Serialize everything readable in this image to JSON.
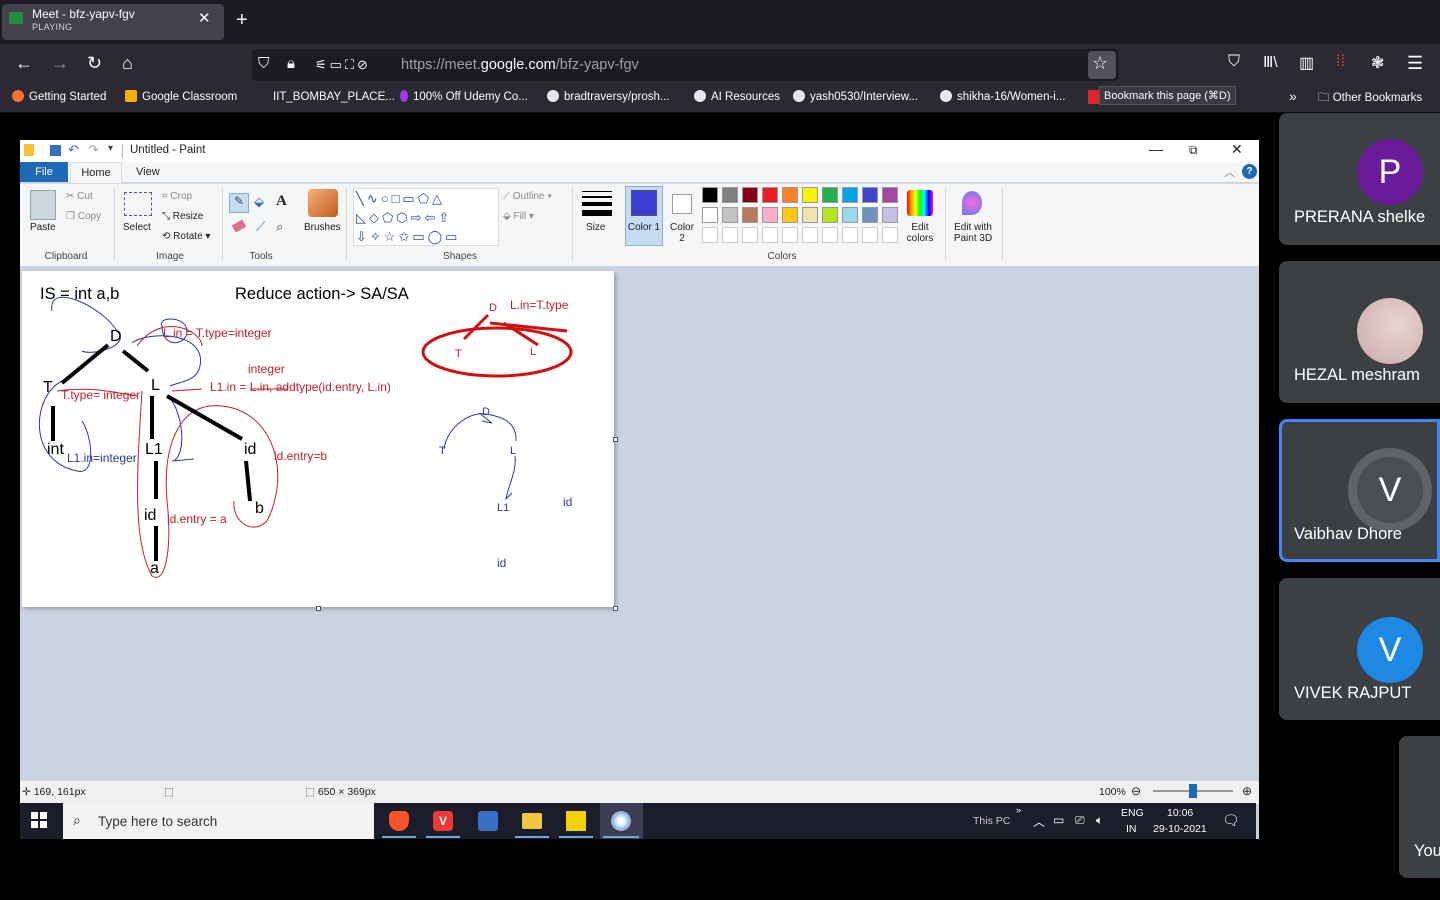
{
  "browser": {
    "tab": {
      "title": "Meet - bfz-yapv-fgv",
      "status": "PLAYING"
    },
    "url": {
      "scheme": "https://meet.",
      "host": "google.com",
      "path": "/bfz-yapv-fgv"
    },
    "bookmarks": [
      "Getting Started",
      "Google Classroom",
      "IIT_BOMBAY_PLACE...",
      "100% Off Udemy Co...",
      "bradtraversy/prosh...",
      "AI Resources",
      "yash0530/Interview...",
      "shikha-16/Women-i..."
    ],
    "tooltip": "Bookmark this page (⌘D)",
    "other_bookmarks": "Other Bookmarks",
    "icons": [
      "back-icon",
      "forward-icon",
      "reload-icon",
      "home-icon",
      "shield-icon",
      "lock-icon",
      "star-icon",
      "pocket-icon",
      "library-icon",
      "sidebar-icon",
      "extension-icon",
      "menu-icon"
    ]
  },
  "paint": {
    "window_title": "Untitled - Paint",
    "menu": {
      "file": "File",
      "home": "Home",
      "view": "View"
    },
    "ribbon": {
      "paste": "Paste",
      "cut": "Cut",
      "copy": "Copy",
      "select": "Select",
      "crop": "Crop",
      "resize": "Resize",
      "rotate": "Rotate",
      "brushes": "Brushes",
      "outline": "Outline",
      "fill": "Fill",
      "size": "Size",
      "color1": "Color 1",
      "color2": "Color 2",
      "edit_colors": "Edit colors",
      "edit_3d": "Edit with Paint 3D",
      "groups": {
        "clipboard": "Clipboard",
        "image": "Image",
        "tools": "Tools",
        "shapes": "Shapes",
        "colors": "Colors"
      },
      "active_color1": "#3d3dd6",
      "palette_row1": [
        "#000000",
        "#7f7f7f",
        "#880015",
        "#ed1c24",
        "#ff7f27",
        "#fff200",
        "#22b14c",
        "#00a2e8",
        "#3f48cc",
        "#a349a4"
      ],
      "palette_row2": [
        "#ffffff",
        "#c3c3c3",
        "#b97a57",
        "#ffaec9",
        "#ffc90e",
        "#efe4b0",
        "#b5e61d",
        "#99d9ea",
        "#7092be",
        "#c8bfe7"
      ]
    },
    "drawing": {
      "heading_left": "IS = int a,b",
      "heading_right": "Reduce action-> SA/SA",
      "nodes": {
        "D": "D",
        "T": "T",
        "L": "L",
        "int": "int",
        "L1": "L1",
        "id": "id",
        "id2": "id",
        "a": "a",
        "b": "b"
      },
      "annotations": {
        "lin_ttype": "L.in = T.type=integer",
        "integer": "integer",
        "l1in": "L1.in = L.in, addtype(id.entry, L.in)",
        "ttype": "T.type= integer",
        "l1in_int": "L1.in=integer",
        "identry_b": "id.entry=b",
        "identry_a": "id.entry = a",
        "right_lin": "L.in=T.type",
        "right_D": "D",
        "right_T": "T",
        "right_L": "L",
        "blue_D": "D",
        "blue_T": "T",
        "blue_L": "L",
        "blue_L1": "L1",
        "blue_id1": "id",
        "blue_id2": "id"
      }
    },
    "status": {
      "position": "169, 161px",
      "size": "650 × 369px",
      "zoom": "100%"
    }
  },
  "windows_taskbar": {
    "search_placeholder": "Type here to search",
    "this_pc": "This PC",
    "lang": "ENG",
    "region": "IN",
    "time": "10:06",
    "date": "29-10-2021"
  },
  "meet": {
    "participants": [
      {
        "initial": "P",
        "name": "PRERANA shelke",
        "color": "#6a1b9a"
      },
      {
        "initial": "",
        "name": "HEZAL meshram",
        "color": "#d8c0bd"
      },
      {
        "initial": "V",
        "name": "Vaibhav Dhore",
        "color": "#4a4e51"
      },
      {
        "initial": "V",
        "name": "VIVEK RAJPUT",
        "color": "#1e88e5"
      }
    ],
    "self_label": "You"
  }
}
